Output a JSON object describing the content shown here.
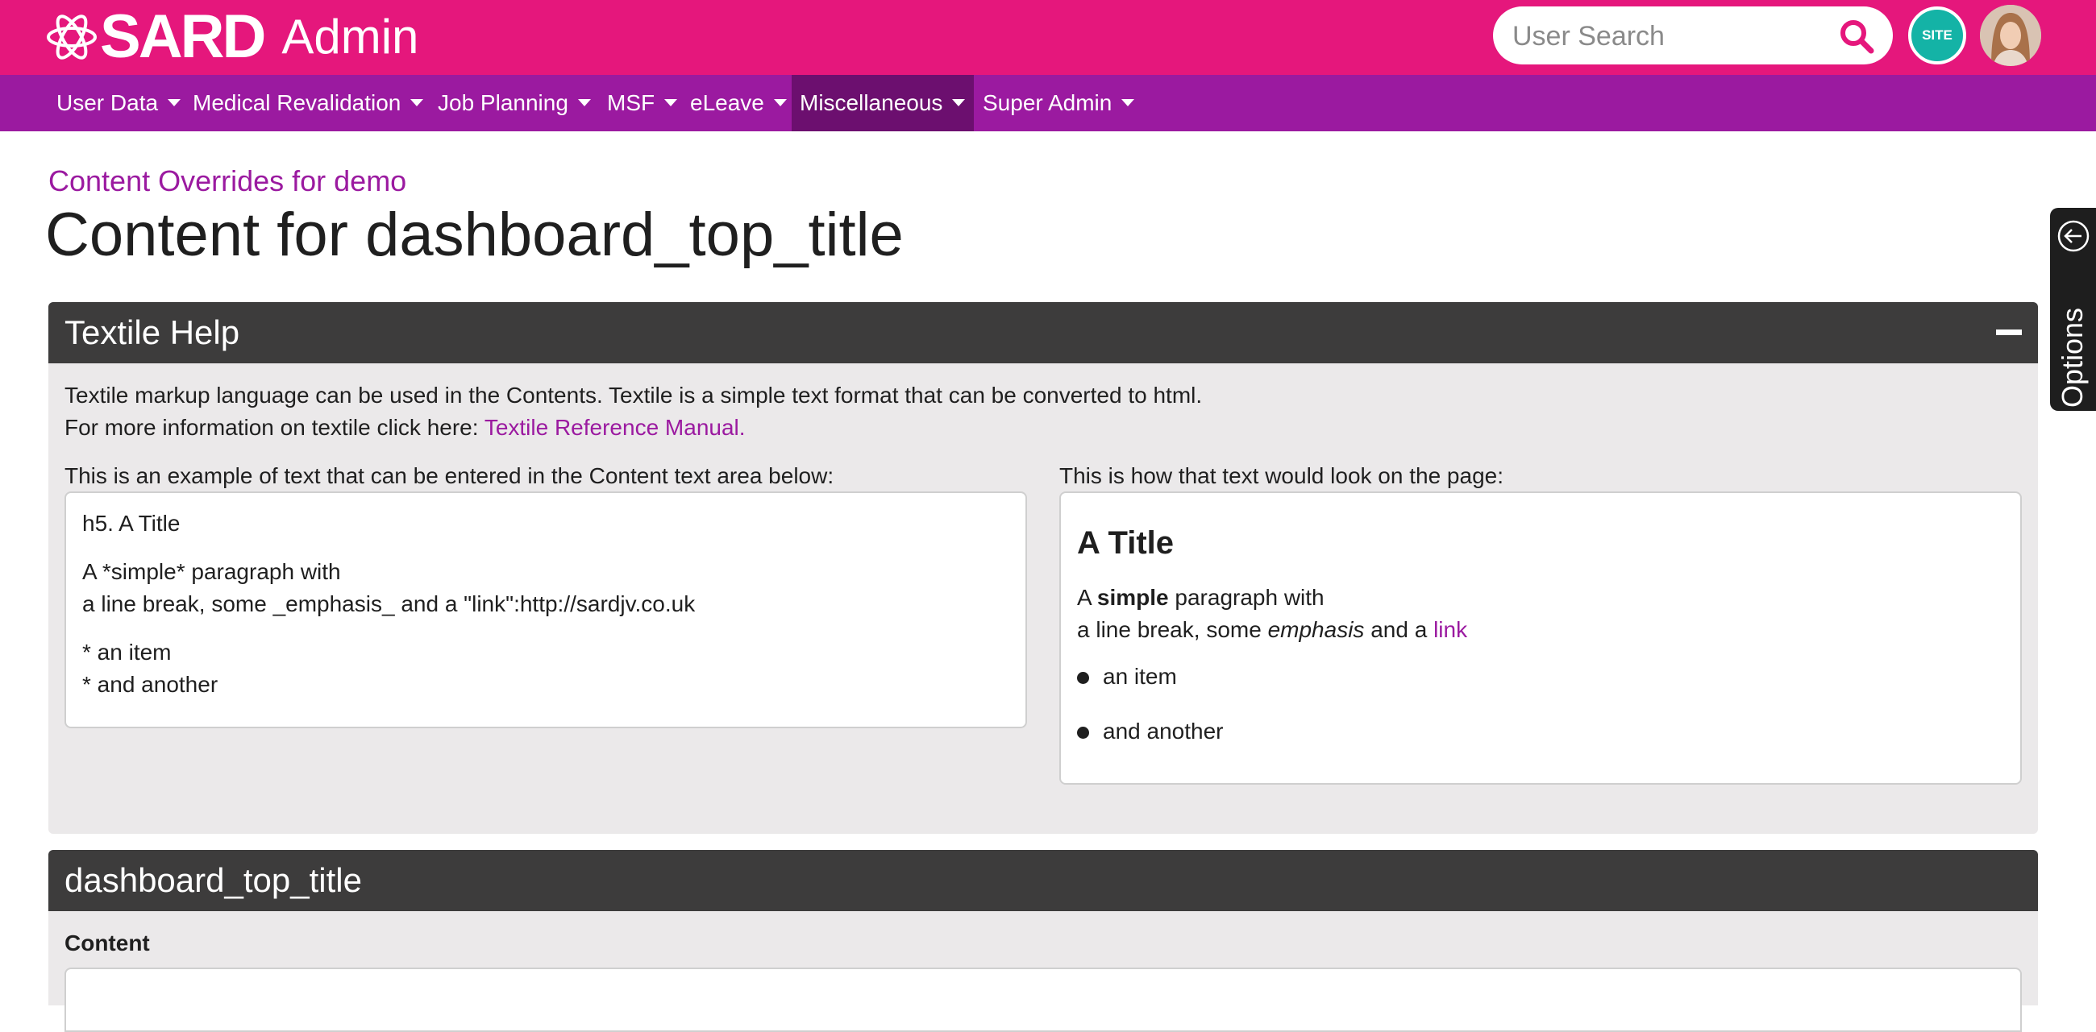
{
  "header": {
    "brand_name": "SARD",
    "brand_suffix": "Admin",
    "search_placeholder": "User Search",
    "site_badge": "SITE",
    "colors": {
      "topbar": "#e5177c",
      "navbar": "#9b1aa0",
      "nav_active": "#6c0f6f"
    }
  },
  "nav": {
    "items": [
      {
        "label": "User Data"
      },
      {
        "label": "Medical Revalidation"
      },
      {
        "label": "Job Planning"
      },
      {
        "label": "MSF"
      },
      {
        "label": "eLeave"
      },
      {
        "label": "Miscellaneous",
        "active": true
      },
      {
        "label": "Super Admin"
      }
    ]
  },
  "page": {
    "subtitle": "Content Overrides for demo",
    "title": "Content for dashboard_top_title"
  },
  "help_panel": {
    "title": "Textile Help",
    "intro_line1": "Textile markup language can be used in the Contents. Textile is a simple text format that can be converted to html.",
    "intro_line2_prefix": "For more information on textile click here: ",
    "intro_link": "Textile Reference Manual.",
    "example_label": "This is an example of text that can be entered in the Content text area below:",
    "render_label": "This is how that text would look on the page:",
    "example_lines": [
      "h5. A Title",
      "A *simple* paragraph with",
      "a line break, some _emphasis_ and a \"link\":http://sardjv.co.uk",
      "* an item",
      "* and another"
    ],
    "render": {
      "title": "A Title",
      "p1_a": "A ",
      "p1_bold": "simple",
      "p1_b": " paragraph with",
      "p2_a": "a line break, some ",
      "p2_em": "emphasis",
      "p2_b": " and a ",
      "p2_link": "link",
      "items": [
        "an item",
        "and another"
      ]
    }
  },
  "content_panel": {
    "title": "dashboard_top_title",
    "field_label": "Content"
  },
  "options_tab": {
    "label": "Options"
  }
}
